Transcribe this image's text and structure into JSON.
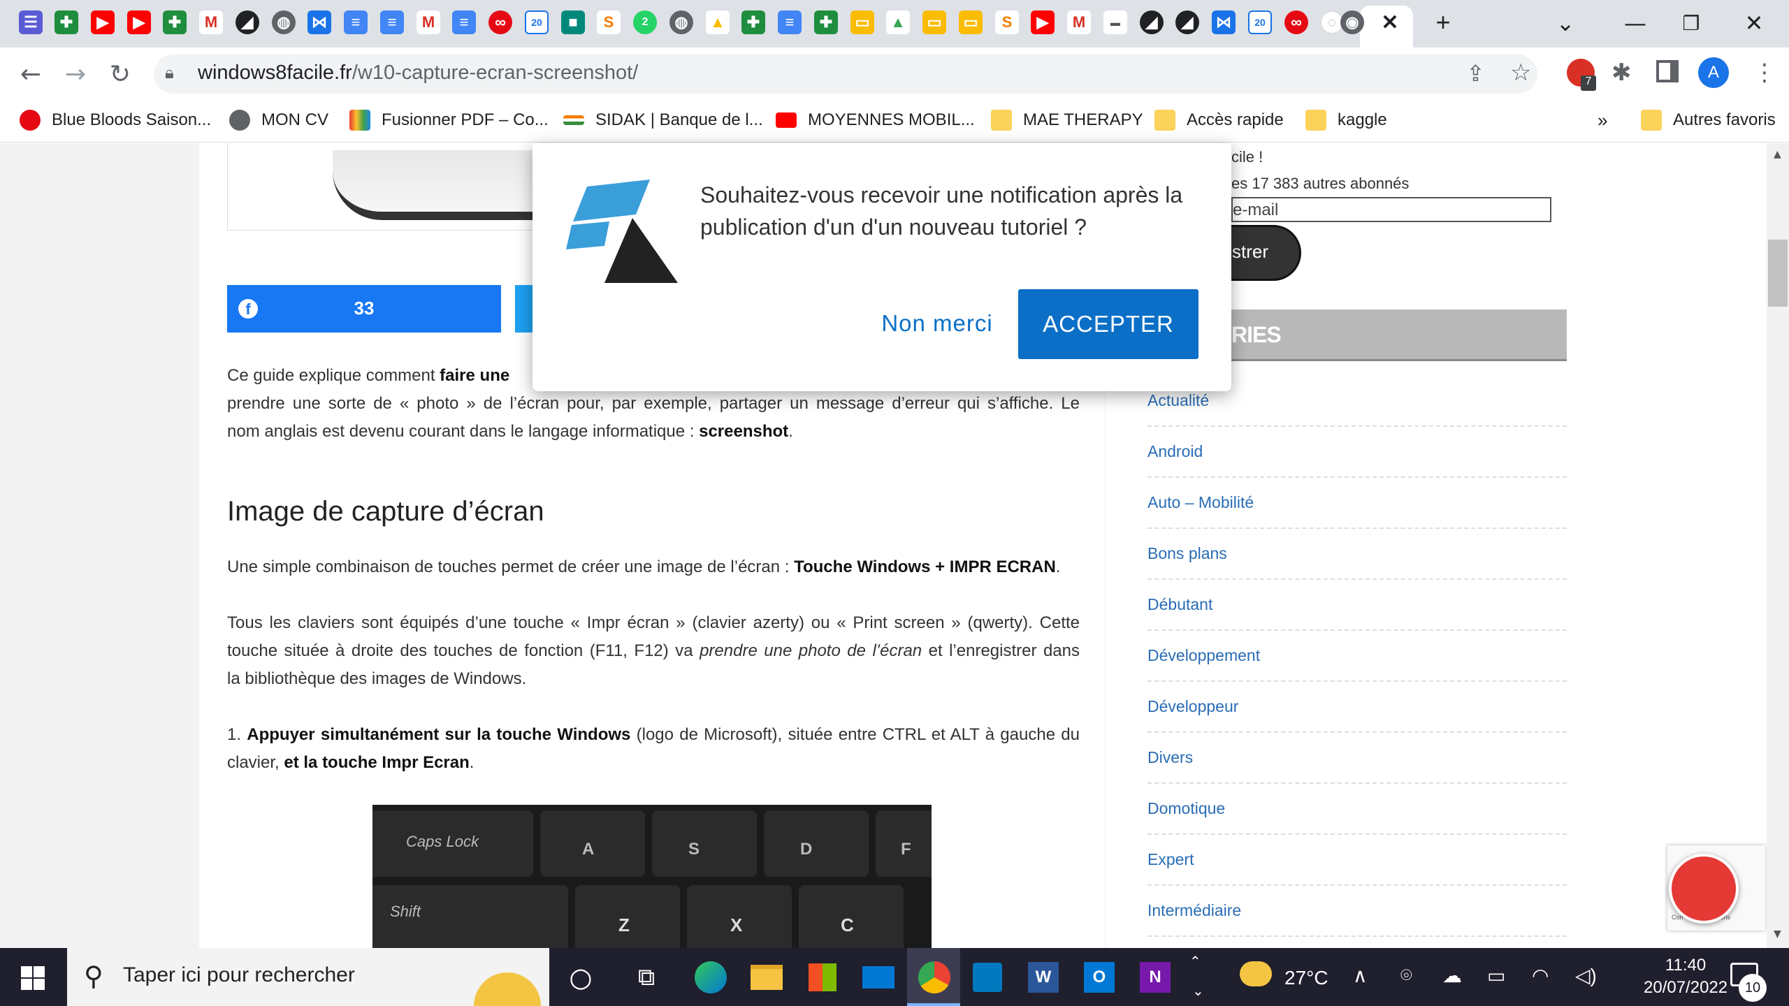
{
  "browser": {
    "url_host": "windows8facile.fr",
    "url_path": "/w10-capture-ecran-screenshot/",
    "extension_badge": "7",
    "profile_initial": "A",
    "bookmarks": [
      {
        "label": "Blue Bloods Saison..."
      },
      {
        "label": "MON CV"
      },
      {
        "label": "Fusionner PDF – Co..."
      },
      {
        "label": "SIDAK | Banque de l..."
      },
      {
        "label": "MOYENNES MOBIL..."
      },
      {
        "label": "MAE THERAPY"
      },
      {
        "label": "Accès rapide"
      },
      {
        "label": "kaggle"
      }
    ],
    "bookmarks_overflow": "»",
    "other_bookmarks": "Autres favoris"
  },
  "article": {
    "share_count": "33",
    "intro_1a": "Ce guide explique comment ",
    "intro_1b": "faire une",
    "intro_2": "prendre une sorte de « photo » de l’écran pour, par exemple, partager un message d’erreur qui s’affiche. Le",
    "intro_3a": "nom anglais est devenu courant dans le langage informatique : ",
    "intro_3b": "screenshot",
    "intro_3c": ".",
    "heading": "Image de capture d’écran",
    "p1a": "Une simple combinaison de touches permet de créer une image de l’écran : ",
    "p1b": "Touche Windows + IMPR ECRAN",
    "p1c": ".",
    "p2_1": "Tous les claviers sont équipés d’une touche « Impr écran » (clavier azerty) ou « Print screen » (qwerty). Cette",
    "p2_2a": "touche située à droite des touches de fonction (F11, F12) va ",
    "p2_2b": "prendre une photo de l’écran",
    "p2_2c": " et l’enregistrer dans",
    "p2_3": "la bibliothèque des images de Windows.",
    "p3_1a": "1. ",
    "p3_1b": "Appuyer simultanément sur la touche Windows",
    "p3_1c": " (logo de Microsoft), située entre CTRL et ALT à gauche du",
    "p3_2a": "clavier, ",
    "p3_2b": "et la touche Impr Ecran",
    "p3_2c": ".",
    "keys": {
      "caps": "Caps Lock",
      "a": "A",
      "s": "S",
      "d": "D",
      "f": "F",
      "shift": "Shift",
      "z": "Z",
      "x": "X",
      "c": "C"
    }
  },
  "sidebar": {
    "subscribe_tail": "cile !",
    "subscribers": "es 17 383 autres abonnés",
    "email_placeholder": "e-mail",
    "register_tail": "strer",
    "section_tail": "RIES",
    "categories": [
      "Actualité",
      "Android",
      "Auto – Mobilité",
      "Bons plans",
      "Débutant",
      "Développement",
      "Développeur",
      "Divers",
      "Domotique",
      "Expert",
      "Intermédiaire"
    ]
  },
  "popup": {
    "message_line1": "Souhaitez-vous recevoir une notification après la",
    "message_line2": "publication d'un d'un nouveau tutoriel ?",
    "decline": "Non merci",
    "accept": "ACCEPTER"
  },
  "recaptcha": {
    "small": "Con          Conditions"
  },
  "taskbar": {
    "search_placeholder": "Taper ici pour rechercher",
    "temperature": "27°C",
    "time": "11:40",
    "date": "20/07/2022",
    "notification_count": "10"
  },
  "colors": {
    "accent": "#0b6fc7",
    "facebook": "#1877f2",
    "taskbar": "#1f1f2e",
    "link": "#2a6db5"
  }
}
